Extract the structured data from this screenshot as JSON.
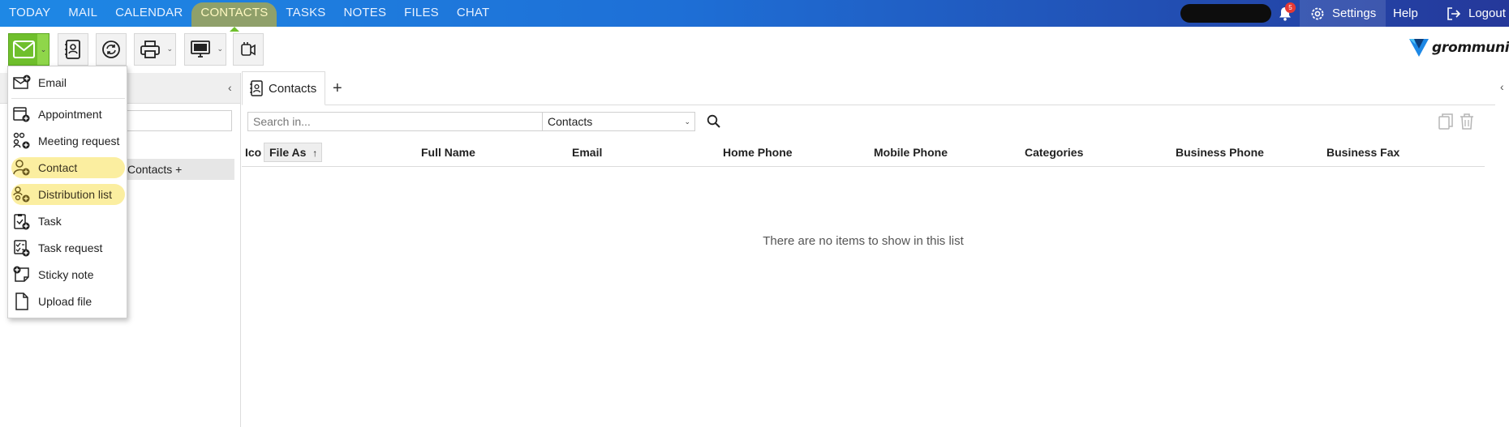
{
  "nav": {
    "items": [
      "TODAY",
      "MAIL",
      "CALENDAR",
      "CONTACTS",
      "TASKS",
      "NOTES",
      "FILES",
      "CHAT"
    ],
    "active": "CONTACTS"
  },
  "header": {
    "notification_count": "5",
    "settings_label": "Settings",
    "help_label": "Help",
    "logout_label": "Logout",
    "logo_text": "grommunio"
  },
  "new_menu": {
    "items": [
      {
        "label": "Email",
        "icon": "email-new-icon"
      },
      {
        "label": "Appointment",
        "icon": "appointment-icon"
      },
      {
        "label": "Meeting request",
        "icon": "meeting-request-icon"
      },
      {
        "label": "Contact",
        "icon": "contact-icon",
        "highlighted": true
      },
      {
        "label": "Distribution list",
        "icon": "distribution-list-icon",
        "highlighted": true
      },
      {
        "label": "Task",
        "icon": "task-icon"
      },
      {
        "label": "Task request",
        "icon": "task-request-icon"
      },
      {
        "label": "Sticky note",
        "icon": "sticky-note-icon"
      },
      {
        "label": "Upload file",
        "icon": "upload-file-icon"
      }
    ]
  },
  "left_panel": {
    "folder_item": "Contacts +"
  },
  "main": {
    "tab_label": "Contacts",
    "add_tab_symbol": "+",
    "search_placeholder": "Search in...",
    "search_scope": "Contacts",
    "columns": [
      "Ico",
      "File As",
      "Full Name",
      "Email",
      "Home Phone",
      "Mobile Phone",
      "Categories",
      "Business Phone",
      "Business Fax"
    ],
    "sort_arrow": "↑",
    "empty_message": "There are no items to show in this list"
  },
  "colors": {
    "accent_green": "#6fbf2c",
    "highlight_yellow": "#fbeea0",
    "topbar_start": "#1e88e5",
    "topbar_end": "#25389a"
  }
}
